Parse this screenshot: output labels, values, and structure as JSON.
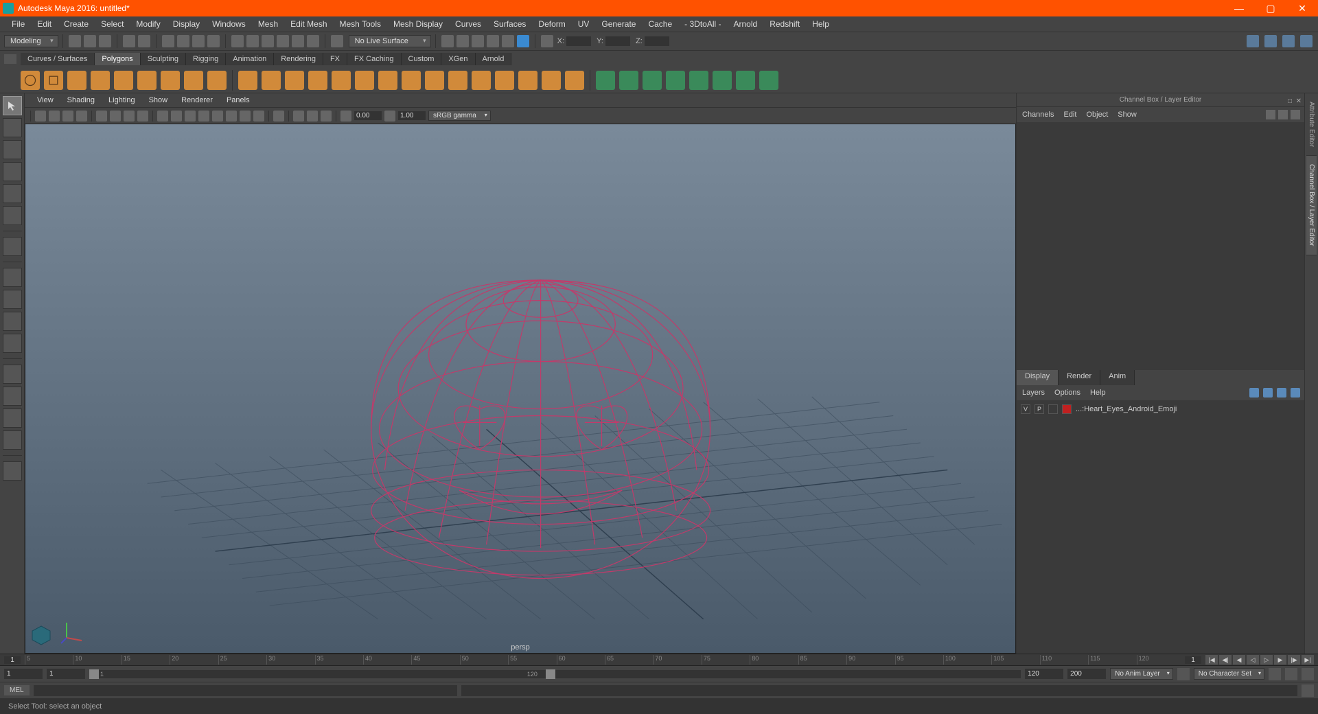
{
  "titlebar": {
    "title": "Autodesk Maya 2016: untitled*"
  },
  "menu": [
    "File",
    "Edit",
    "Create",
    "Select",
    "Modify",
    "Display",
    "Windows",
    "Mesh",
    "Edit Mesh",
    "Mesh Tools",
    "Mesh Display",
    "Curves",
    "Surfaces",
    "Deform",
    "UV",
    "Generate",
    "Cache",
    "- 3DtoAll -",
    "Arnold",
    "Redshift",
    "Help"
  ],
  "mode": "Modeling",
  "live_surface": "No Live Surface",
  "coords": {
    "x": "X:",
    "y": "Y:",
    "z": "Z:"
  },
  "shelftabs": [
    "Curves / Surfaces",
    "Polygons",
    "Sculpting",
    "Rigging",
    "Animation",
    "Rendering",
    "FX",
    "FX Caching",
    "Custom",
    "XGen",
    "Arnold"
  ],
  "shelftab_active": 1,
  "viewport_menu": [
    "View",
    "Shading",
    "Lighting",
    "Show",
    "Renderer",
    "Panels"
  ],
  "vp_exposure": "0.00",
  "vp_gamma": "1.00",
  "vp_colorspace": "sRGB gamma",
  "persp_label": "persp",
  "channelbox": {
    "header": "Channel Box / Layer Editor",
    "menu": [
      "Channels",
      "Edit",
      "Object",
      "Show"
    ]
  },
  "layertabs": [
    "Display",
    "Render",
    "Anim"
  ],
  "layermenu": [
    "Layers",
    "Options",
    "Help"
  ],
  "layer": {
    "v": "V",
    "p": "P",
    "name": "...:Heart_Eyes_Android_Emoji"
  },
  "timeline": {
    "current": "1",
    "ticks": [
      "5",
      "10",
      "15",
      "20",
      "25",
      "30",
      "35",
      "40",
      "45",
      "50",
      "55",
      "60",
      "65",
      "70",
      "75",
      "80",
      "85",
      "90",
      "95",
      "100",
      "105",
      "110",
      "115",
      "120"
    ],
    "right_current": "1"
  },
  "range": {
    "start": "1",
    "end_vis": "1",
    "slider_start": "1",
    "slider_end": "120",
    "total_start": "120",
    "total_end": "200",
    "animlayer": "No Anim Layer",
    "charset": "No Character Set"
  },
  "cmd": {
    "lang": "MEL"
  },
  "helpline": "Select Tool: select an object",
  "sidetabs": [
    "Attribute Editor",
    "Channel Box / Layer Editor"
  ]
}
